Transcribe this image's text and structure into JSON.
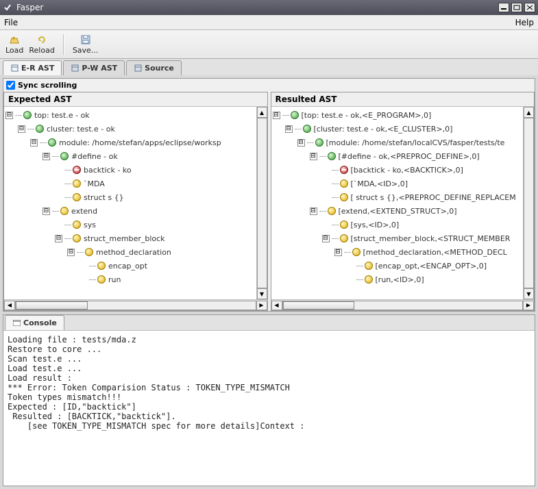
{
  "window": {
    "title": "Fasper"
  },
  "menubar": {
    "file": "File",
    "help": "Help"
  },
  "toolbar": {
    "load": "Load",
    "reload": "Reload",
    "save": "Save..."
  },
  "tabs": [
    {
      "label": "E-R AST",
      "active": true
    },
    {
      "label": "P-W AST",
      "active": false
    },
    {
      "label": "Source",
      "active": false
    }
  ],
  "sync": {
    "label": "Sync scrolling",
    "checked": true
  },
  "panels": {
    "expected": {
      "title": "Expected AST",
      "nodes": [
        {
          "depth": 0,
          "toggle": "open",
          "icon": "green",
          "label": "top: test.e - ok"
        },
        {
          "depth": 1,
          "toggle": "open",
          "icon": "green",
          "label": "cluster: test.e - ok"
        },
        {
          "depth": 2,
          "toggle": "open",
          "icon": "green",
          "label": "module: /home/stefan/apps/eclipse/worksp"
        },
        {
          "depth": 3,
          "toggle": "open",
          "icon": "green",
          "label": "#define - ok"
        },
        {
          "depth": 4,
          "toggle": "leaf",
          "icon": "red",
          "label": "backtick - ko"
        },
        {
          "depth": 4,
          "toggle": "leaf",
          "icon": "yellow",
          "label": "`MDA"
        },
        {
          "depth": 4,
          "toggle": "leaf",
          "icon": "yellow",
          "label": "struct s {}"
        },
        {
          "depth": 3,
          "toggle": "closed",
          "icon": "yellow",
          "label": "extend"
        },
        {
          "depth": 4,
          "toggle": "leaf",
          "icon": "yellow",
          "label": "sys"
        },
        {
          "depth": 4,
          "toggle": "open",
          "icon": "yellow",
          "label": "struct_member_block"
        },
        {
          "depth": 5,
          "toggle": "open",
          "icon": "yellow",
          "label": "method_declaration"
        },
        {
          "depth": 6,
          "toggle": "leaf",
          "icon": "yellow",
          "label": "encap_opt"
        },
        {
          "depth": 6,
          "toggle": "leaf",
          "icon": "yellow",
          "label": "run"
        }
      ]
    },
    "resulted": {
      "title": "Resulted AST",
      "nodes": [
        {
          "depth": 0,
          "toggle": "open",
          "icon": "green",
          "label": "[top: test.e - ok,<E_PROGRAM>,0]"
        },
        {
          "depth": 1,
          "toggle": "open",
          "icon": "green",
          "label": "[cluster: test.e - ok,<E_CLUSTER>,0]"
        },
        {
          "depth": 2,
          "toggle": "open",
          "icon": "green",
          "label": "[module: /home/stefan/localCVS/fasper/tests/te"
        },
        {
          "depth": 3,
          "toggle": "open",
          "icon": "green",
          "label": "[#define - ok,<PREPROC_DEFINE>,0]"
        },
        {
          "depth": 4,
          "toggle": "leaf",
          "icon": "red",
          "label": "[backtick - ko,<BACKTICK>,0]"
        },
        {
          "depth": 4,
          "toggle": "leaf",
          "icon": "yellow",
          "label": "[`MDA,<ID>,0]"
        },
        {
          "depth": 4,
          "toggle": "leaf",
          "icon": "yellow",
          "label": "[ struct s {},<PREPROC_DEFINE_REPLACEM"
        },
        {
          "depth": 3,
          "toggle": "open",
          "icon": "yellow",
          "label": "[extend,<EXTEND_STRUCT>,0]"
        },
        {
          "depth": 4,
          "toggle": "leaf",
          "icon": "yellow",
          "label": "[sys,<ID>,0]"
        },
        {
          "depth": 4,
          "toggle": "open",
          "icon": "yellow",
          "label": "[struct_member_block,<STRUCT_MEMBER"
        },
        {
          "depth": 5,
          "toggle": "open",
          "icon": "yellow",
          "label": "[method_declaration,<METHOD_DECL"
        },
        {
          "depth": 6,
          "toggle": "leaf",
          "icon": "yellow",
          "label": "[encap_opt,<ENCAP_OPT>,0]"
        },
        {
          "depth": 6,
          "toggle": "leaf",
          "icon": "yellow",
          "label": "[run,<ID>,0]"
        }
      ]
    }
  },
  "console": {
    "tab": "Console",
    "text": "Loading file : tests/mda.z\nRestore to core ...\nScan test.e ...\nLoad test.e ...\nLoad result :\n*** Error: Token Comparision Status : TOKEN_TYPE_MISMATCH\nToken types mismatch!!!\nExpected : [ID,\"backtick\"]\n Resulted : [BACKTICK,\"backtick\"].\n    [see TOKEN_TYPE_MISMATCH spec for more details]Context :"
  }
}
